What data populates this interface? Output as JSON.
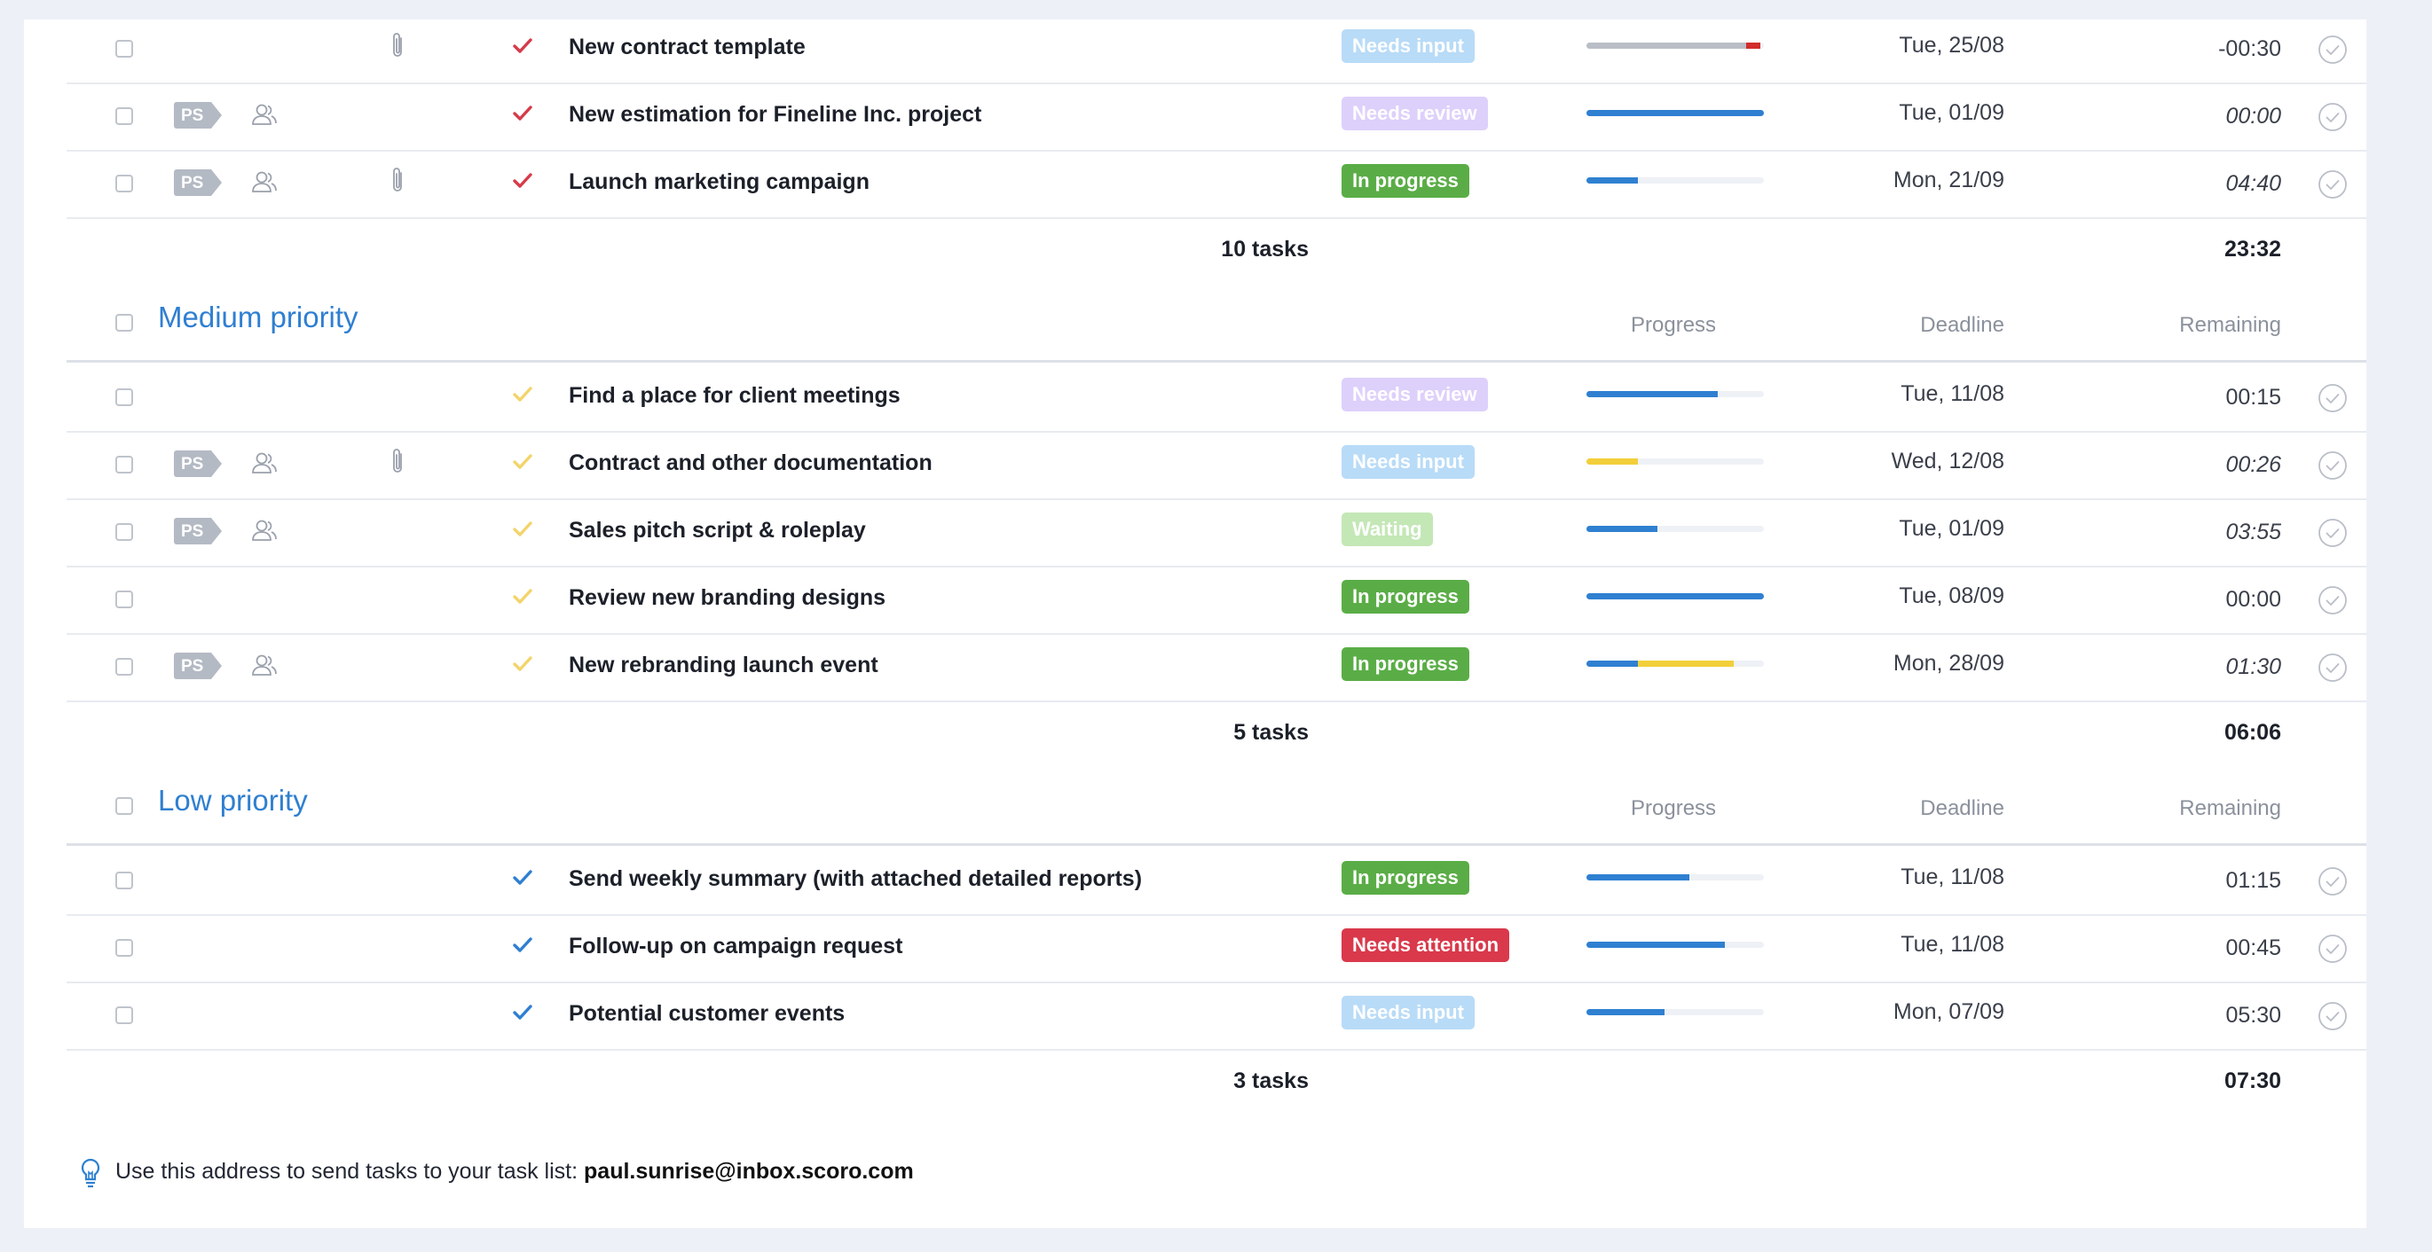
{
  "colors": {
    "accent": "#2f7fd1",
    "high_check": "#d63b4a",
    "medium_check": "#f3d46b",
    "low_check": "#2f7fd1",
    "badge_needs_input": "#b8dbf7",
    "badge_needs_review": "#ddd0fb",
    "badge_in_progress": "#5aad46",
    "badge_waiting": "#c4e7b6",
    "badge_needs_attention": "#d9394b",
    "progress_blue": "#2f80d1",
    "progress_yellow": "#f2cf3a",
    "progress_red": "#d22c2c",
    "progress_gray": "#b9bec7"
  },
  "columns": {
    "progress": "Progress",
    "deadline": "Deadline",
    "remaining": "Remaining"
  },
  "groups": [
    {
      "name": "",
      "summary": {
        "count": "10 tasks",
        "total": "23:32"
      },
      "tasks": [
        {
          "title": "New contract template",
          "status": "Needs input",
          "deadline": "Tue, 25/08",
          "remaining": "-00:30",
          "italic": false,
          "ps": false,
          "clip": true,
          "progress": [
            {
              "color": "gray",
              "value": 0.9
            },
            {
              "color": "red",
              "value": 0.08
            }
          ]
        },
        {
          "title": "New estimation for Fineline Inc. project",
          "status": "Needs review",
          "deadline": "Tue, 01/09",
          "remaining": "00:00",
          "italic": true,
          "ps": true,
          "clip": false,
          "progress": [
            {
              "color": "blue",
              "value": 1.0
            }
          ]
        },
        {
          "title": "Launch marketing campaign",
          "status": "In progress",
          "deadline": "Mon, 21/09",
          "remaining": "04:40",
          "italic": true,
          "ps": true,
          "clip": true,
          "progress": [
            {
              "color": "blue",
              "value": 0.29
            }
          ]
        }
      ]
    },
    {
      "name": "Medium priority",
      "summary": {
        "count": "5 tasks",
        "total": "06:06"
      },
      "tasks": [
        {
          "title": "Find a place for client meetings",
          "status": "Needs review",
          "deadline": "Tue, 11/08",
          "remaining": "00:15",
          "italic": false,
          "ps": false,
          "clip": false,
          "progress": [
            {
              "color": "blue",
              "value": 0.74
            }
          ]
        },
        {
          "title": "Contract and other documentation",
          "status": "Needs input",
          "deadline": "Wed, 12/08",
          "remaining": "00:26",
          "italic": true,
          "ps": true,
          "clip": true,
          "progress": [
            {
              "color": "yellow",
              "value": 0.29
            }
          ]
        },
        {
          "title": "Sales pitch script & roleplay",
          "status": "Waiting",
          "deadline": "Tue, 01/09",
          "remaining": "03:55",
          "italic": true,
          "ps": true,
          "clip": false,
          "progress": [
            {
              "color": "blue",
              "value": 0.4
            }
          ]
        },
        {
          "title": "Review new branding designs",
          "status": "In progress",
          "deadline": "Tue, 08/09",
          "remaining": "00:00",
          "italic": false,
          "ps": false,
          "clip": false,
          "progress": [
            {
              "color": "blue",
              "value": 1.0
            }
          ]
        },
        {
          "title": "New rebranding launch event",
          "status": "In progress",
          "deadline": "Mon, 28/09",
          "remaining": "01:30",
          "italic": true,
          "ps": true,
          "clip": false,
          "progress": [
            {
              "color": "blue",
              "value": 0.29
            },
            {
              "color": "yellow",
              "value": 0.54
            }
          ]
        }
      ]
    },
    {
      "name": "Low priority",
      "summary": {
        "count": "3 tasks",
        "total": "07:30"
      },
      "tasks": [
        {
          "title": "Send weekly summary (with attached detailed reports)",
          "status": "In progress",
          "deadline": "Tue, 11/08",
          "remaining": "01:15",
          "italic": false,
          "ps": false,
          "clip": false,
          "progress": [
            {
              "color": "blue",
              "value": 0.58
            }
          ]
        },
        {
          "title": "Follow-up on campaign request",
          "status": "Needs attention",
          "deadline": "Tue, 11/08",
          "remaining": "00:45",
          "italic": false,
          "ps": false,
          "clip": false,
          "progress": [
            {
              "color": "blue",
              "value": 0.78
            }
          ]
        },
        {
          "title": "Potential customer events",
          "status": "Needs input",
          "deadline": "Mon, 07/09",
          "remaining": "05:30",
          "italic": false,
          "ps": false,
          "clip": false,
          "progress": [
            {
              "color": "blue",
              "value": 0.44
            }
          ]
        }
      ]
    }
  ],
  "ps_label": "PS",
  "icons": {
    "people": "people-icon",
    "clip": "paperclip-icon",
    "check": "checkmark-icon",
    "done": "complete-circle-icon",
    "bulb": "lightbulb-icon"
  },
  "footer": {
    "text": "Use this address to send tasks to your task list: ",
    "email": "paul.sunrise@inbox.scoro.com"
  }
}
